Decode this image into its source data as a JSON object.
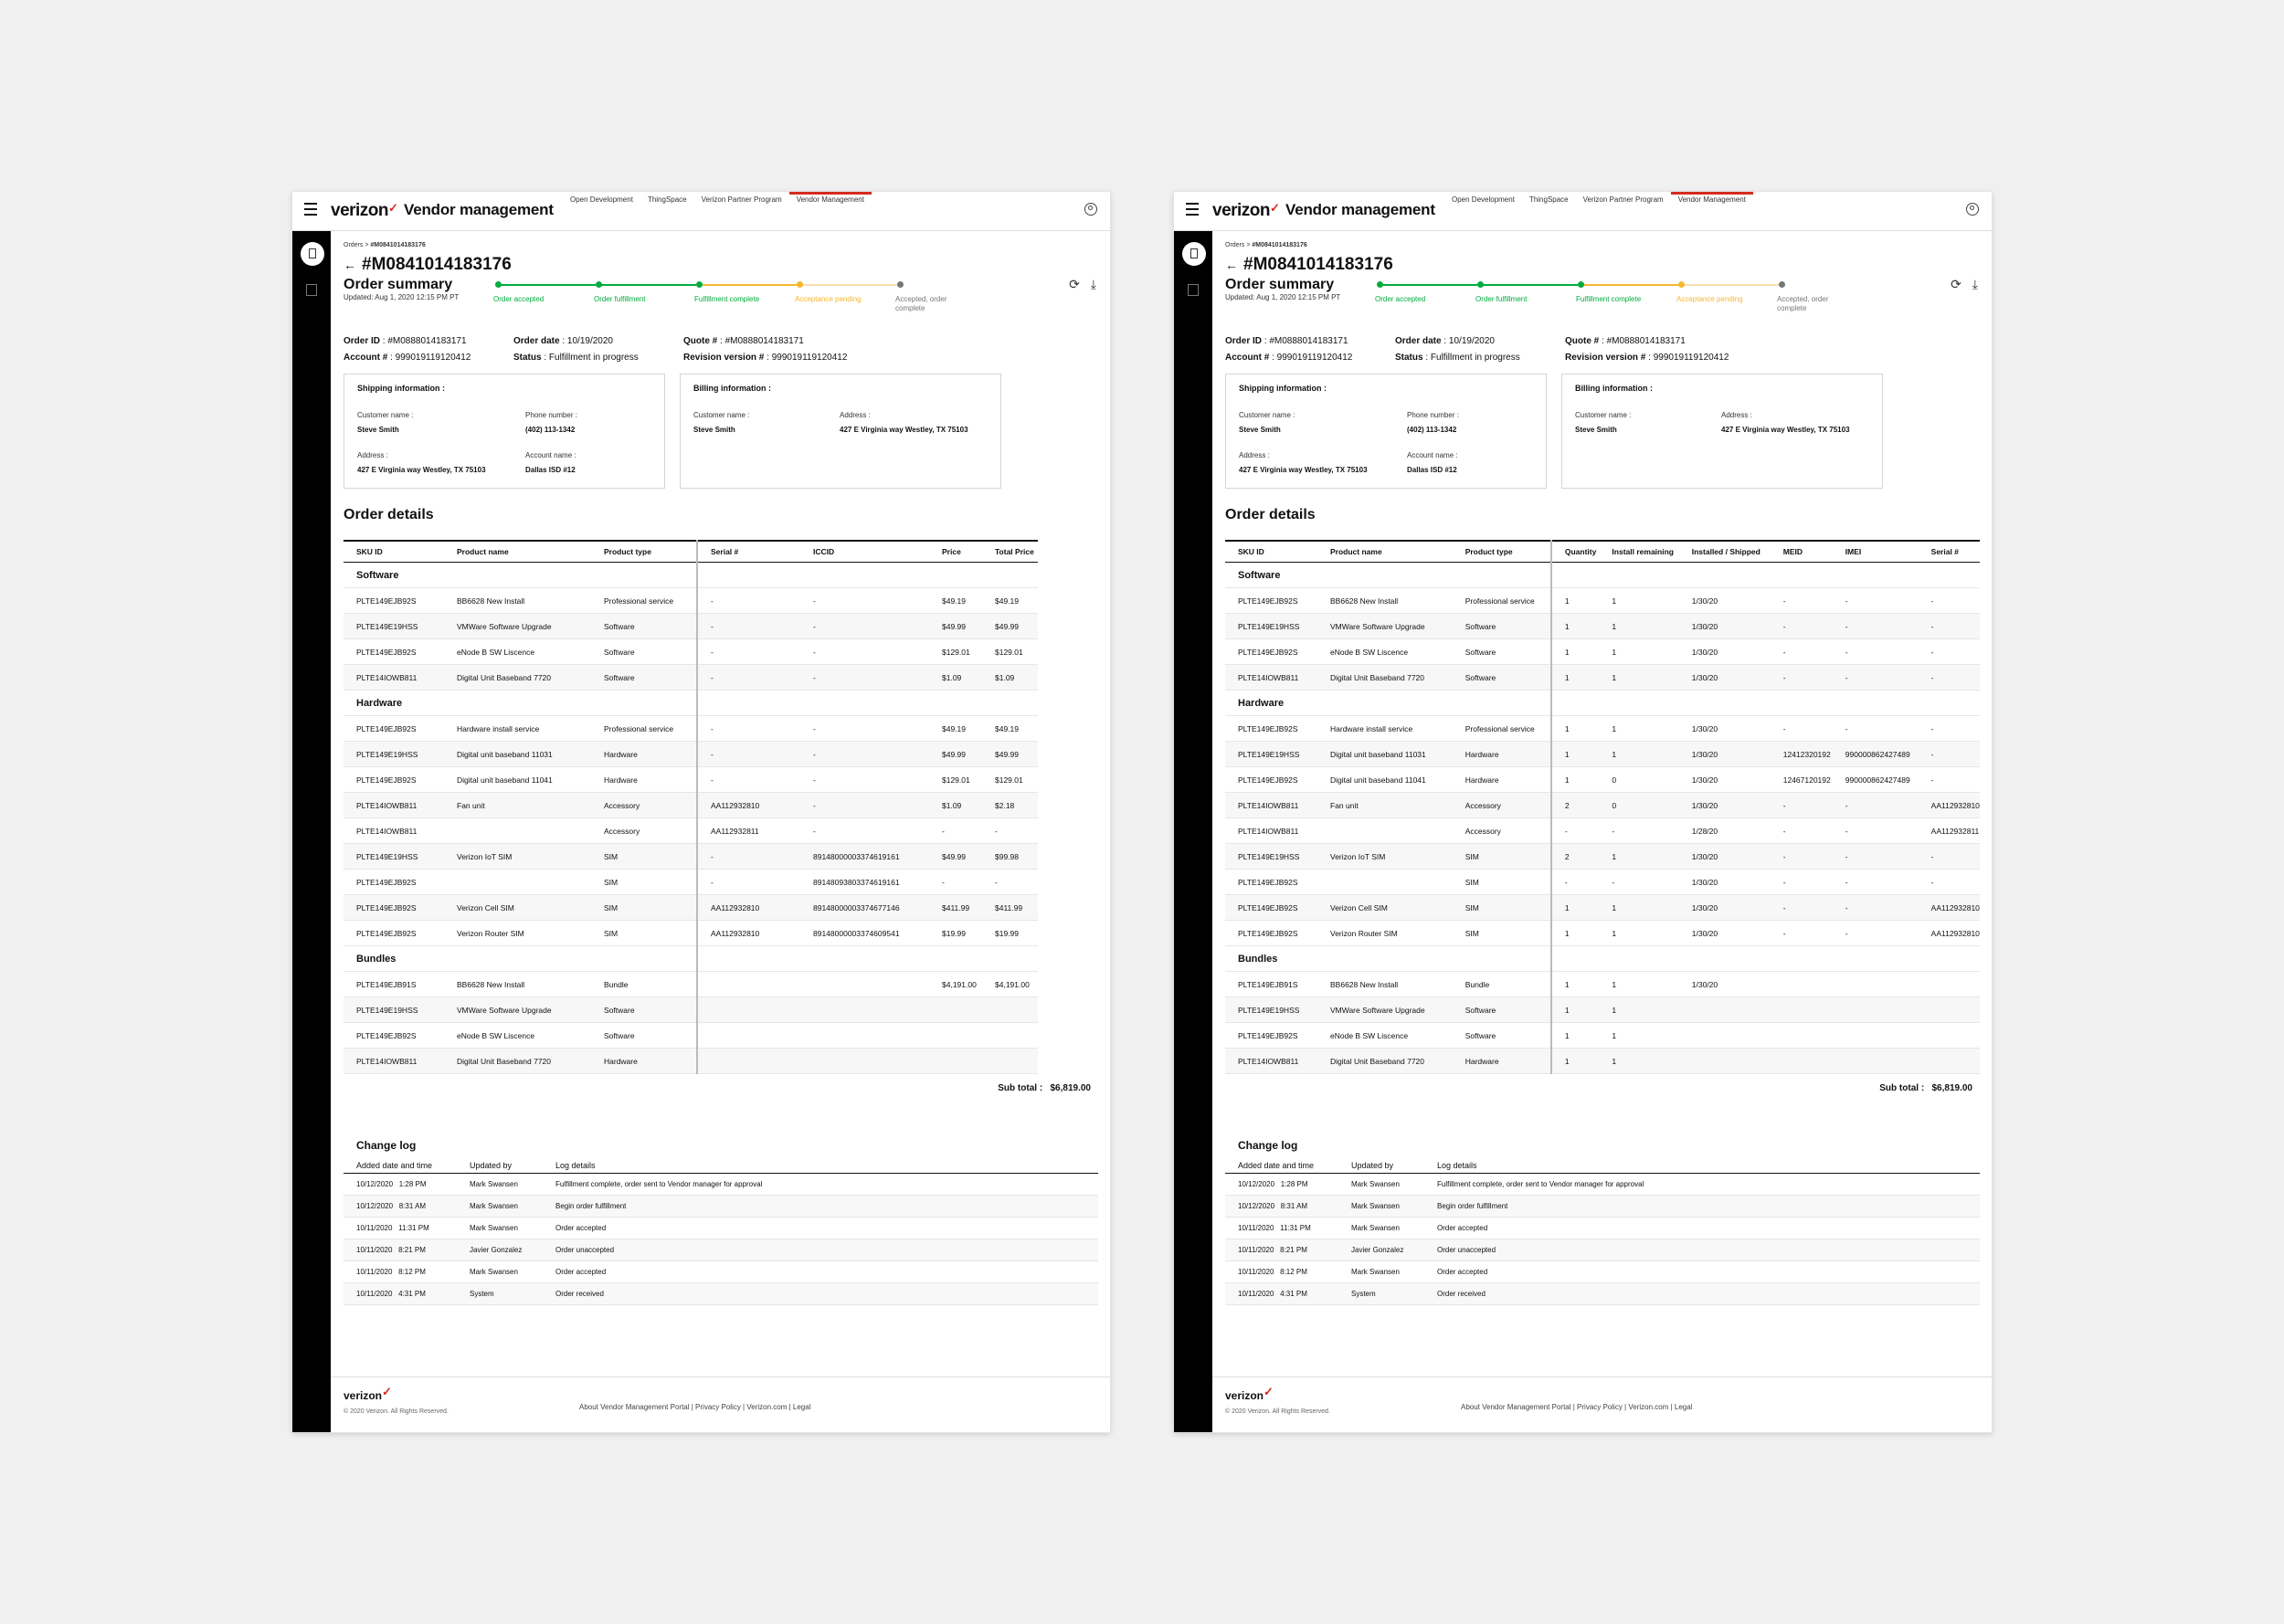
{
  "app": {
    "brand": "verizon",
    "brand_check": "✓",
    "title": "Vendor management",
    "nav": [
      "Open Development",
      "ThingSpace",
      "Verizon Partner Program",
      "Vendor Management"
    ]
  },
  "breadcrumb": {
    "root": "Orders",
    "current": "#M0841014183176"
  },
  "order": {
    "number": "#M0841014183176"
  },
  "summary": {
    "title": "Order summary",
    "updated": "Updated: Aug 1, 2020  12:15 PM PT",
    "steps": [
      {
        "label": "Order accepted",
        "status": "done"
      },
      {
        "label": "Order fulfillment",
        "status": "done"
      },
      {
        "label": "Fulfillment complete",
        "status": "done"
      },
      {
        "label": "Acceptance pending",
        "status": "pending"
      },
      {
        "label": "Accepted, order complete",
        "status": "todo"
      }
    ]
  },
  "meta": {
    "order_id_label": "Order ID",
    "order_id": ": #M0888014183171",
    "order_date_label": "Order date",
    "order_date": ": 10/19/2020",
    "quote_label": "Quote #",
    "quote": ": #M0888014183171",
    "account_label": "Account #",
    "account": ": 999019119120412",
    "status_label": "Status",
    "status": ": Fulfillment in progress",
    "revision_label": "Revision version #",
    "revision": ": 999019119120412"
  },
  "shipping": {
    "title": "Shipping information :",
    "customer_label": "Customer name :",
    "customer": "Steve Smith",
    "phone_label": "Phone number :",
    "phone": "(402) 113-1342",
    "address_label": "Address :",
    "address": "427 E Virginia way Westley, TX 75103",
    "account_label": "Account name :",
    "account": "Dallas ISD #12"
  },
  "billing": {
    "title": "Billing information :",
    "customer_label": "Customer name :",
    "customer": "Steve Smith",
    "address_label": "Address :",
    "address": "427 E Virginia way Westley, TX 75103"
  },
  "order_details": {
    "title": "Order details",
    "sub_total_label": "Sub total :",
    "sub_total": "$6,819.00",
    "columns_a": [
      "SKU ID",
      "Product name",
      "Product type",
      "Serial #",
      "ICCID",
      "Price",
      "Total Price"
    ],
    "columns_b": [
      "SKU ID",
      "Product name",
      "Product type",
      "Quantity",
      "Install remaining",
      "Installed / Shipped",
      "MEID",
      "IMEI",
      "Serial #"
    ],
    "groups": [
      {
        "name": "Software",
        "rows": [
          {
            "sku": "PLTE149EJB92S",
            "name": "BB6628 New Install",
            "type": "Professional service",
            "serial": "-",
            "iccid": "-",
            "price": "$49.19",
            "total": "$49.19",
            "qty": "1",
            "rem": "1",
            "inst": "1/30/20",
            "meid": "-",
            "imei": "-",
            "serialb": "-"
          },
          {
            "sku": "PLTE149E19HSS",
            "name": "VMWare Software Upgrade",
            "type": "Software",
            "serial": "-",
            "iccid": "-",
            "price": "$49.99",
            "total": "$49.99",
            "qty": "1",
            "rem": "1",
            "inst": "1/30/20",
            "meid": "-",
            "imei": "-",
            "serialb": "-"
          },
          {
            "sku": "PLTE149EJB92S",
            "name": "eNode B SW Liscence",
            "type": "Software",
            "serial": "-",
            "iccid": "-",
            "price": "$129.01",
            "total": "$129.01",
            "qty": "1",
            "rem": "1",
            "inst": "1/30/20",
            "meid": "-",
            "imei": "-",
            "serialb": "-"
          },
          {
            "sku": "PLTE14IOWB811",
            "name": "Digital Unit Baseband 7720",
            "type": "Software",
            "serial": "-",
            "iccid": "-",
            "price": "$1.09",
            "total": "$1.09",
            "qty": "1",
            "rem": "1",
            "inst": "1/30/20",
            "meid": "-",
            "imei": "-",
            "serialb": "-"
          }
        ]
      },
      {
        "name": "Hardware",
        "rows": [
          {
            "sku": "PLTE149EJB92S",
            "name": "Hardware install service",
            "type": "Professional service",
            "serial": "-",
            "iccid": "-",
            "price": "$49.19",
            "total": "$49.19",
            "qty": "1",
            "rem": "1",
            "inst": "1/30/20",
            "meid": "-",
            "imei": "-",
            "serialb": "-"
          },
          {
            "sku": "PLTE149E19HSS",
            "name": "Digital unit baseband 11031",
            "type": "Hardware",
            "serial": "-",
            "iccid": "-",
            "price": "$49.99",
            "total": "$49.99",
            "qty": "1",
            "rem": "1",
            "inst": "1/30/20",
            "meid": "12412320192",
            "imei": "990000862427489",
            "serialb": "-"
          },
          {
            "sku": "PLTE149EJB92S",
            "name": "Digital unit baseband 11041",
            "type": "Hardware",
            "serial": "-",
            "iccid": "-",
            "price": "$129.01",
            "total": "$129.01",
            "qty": "1",
            "rem": "0",
            "inst": "1/30/20",
            "meid": "12467120192",
            "imei": "990000862427489",
            "serialb": "-"
          },
          {
            "sku": "PLTE14IOWB811",
            "name": "Fan unit",
            "type": "Accessory",
            "serial": "AA112932810",
            "iccid": "-",
            "price": "$1.09",
            "total": "$2.18",
            "qty": "2",
            "rem": "0",
            "inst": "1/30/20",
            "meid": "-",
            "imei": "-",
            "serialb": "AA112932810"
          },
          {
            "sku": "PLTE14IOWB811",
            "name": "",
            "type": "Accessory",
            "serial": "AA112932811",
            "iccid": "-",
            "price": "-",
            "total": "-",
            "qty": "-",
            "rem": "-",
            "inst": "1/28/20",
            "meid": "-",
            "imei": "-",
            "serialb": "AA112932811"
          },
          {
            "sku": "PLTE149E19HSS",
            "name": "Verizon IoT SIM",
            "type": "SIM",
            "serial": "-",
            "iccid": "89148000003374619161",
            "price": "$49.99",
            "total": "$99.98",
            "qty": "2",
            "rem": "1",
            "inst": "1/30/20",
            "meid": "-",
            "imei": "-",
            "serialb": "-"
          },
          {
            "sku": "PLTE149EJB92S",
            "name": "",
            "type": "SIM",
            "serial": "-",
            "iccid": "89148093803374619161",
            "price": "-",
            "total": "-",
            "qty": "-",
            "rem": "-",
            "inst": "1/30/20",
            "meid": "-",
            "imei": "-",
            "serialb": "-"
          },
          {
            "sku": "PLTE149EJB92S",
            "name": "Verizon Cell SIM",
            "type": "SIM",
            "serial": "AA112932810",
            "iccid": "89148000003374677146",
            "price": "$411.99",
            "total": "$411.99",
            "qty": "1",
            "rem": "1",
            "inst": "1/30/20",
            "meid": "-",
            "imei": "-",
            "serialb": "AA112932810"
          },
          {
            "sku": "PLTE149EJB92S",
            "name": "Verizon Router SIM",
            "type": "SIM",
            "serial": "AA112932810",
            "iccid": "89148000003374609541",
            "price": "$19.99",
            "total": "$19.99",
            "qty": "1",
            "rem": "1",
            "inst": "1/30/20",
            "meid": "-",
            "imei": "-",
            "serialb": "AA112932810"
          }
        ]
      },
      {
        "name": "Bundles",
        "rows": [
          {
            "sku": "PLTE149EJB91S",
            "name": "BB6628 New Install",
            "type": "Bundle",
            "serial": "",
            "iccid": "",
            "price": "$4,191.00",
            "total": "$4,191.00",
            "qty": "1",
            "rem": "1",
            "inst": "1/30/20",
            "meid": "",
            "imei": "",
            "serialb": ""
          },
          {
            "sku": "PLTE149E19HSS",
            "name": "VMWare Software Upgrade",
            "type": "Software",
            "serial": "",
            "iccid": "",
            "price": "",
            "total": "",
            "qty": "1",
            "rem": "1",
            "inst": "",
            "meid": "",
            "imei": "",
            "serialb": ""
          },
          {
            "sku": "PLTE149EJB92S",
            "name": "eNode B SW Liscence",
            "type": "Software",
            "serial": "",
            "iccid": "",
            "price": "",
            "total": "",
            "qty": "1",
            "rem": "1",
            "inst": "",
            "meid": "",
            "imei": "",
            "serialb": ""
          },
          {
            "sku": "PLTE14IOWB811",
            "name": "Digital Unit Baseband 7720",
            "type": "Hardware",
            "serial": "",
            "iccid": "",
            "price": "",
            "total": "",
            "qty": "1",
            "rem": "1",
            "inst": "",
            "meid": "",
            "imei": "",
            "serialb": ""
          }
        ]
      }
    ]
  },
  "change_log": {
    "title": "Change log",
    "columns": [
      "Added date and time",
      "Updated by",
      "Log details"
    ],
    "rows": [
      {
        "date": "10/12/2020",
        "time": "1:28 PM",
        "by": "Mark Swansen",
        "details": "Fulfillment complete, order sent to Vendor manager for approval"
      },
      {
        "date": "10/12/2020",
        "time": "8:31 AM",
        "by": "Mark Swansen",
        "details": "Begin order fulfillment"
      },
      {
        "date": "10/11/2020",
        "time": "11:31 PM",
        "by": "Mark Swansen",
        "details": "Order accepted"
      },
      {
        "date": "10/11/2020",
        "time": "8:21 PM",
        "by": "Javier Gonzalez",
        "details": "Order unaccepted"
      },
      {
        "date": "10/11/2020",
        "time": "8:12 PM",
        "by": "Mark Swansen",
        "details": "Order accepted"
      },
      {
        "date": "10/11/2020",
        "time": "4:31 PM",
        "by": "System",
        "details": "Order received"
      }
    ]
  },
  "footer": {
    "brand": "verizon",
    "copyright": "© 2020 Verizon. All Rights Reserved.",
    "links": "About Vendor Management Portal  |  Privacy Policy  |  Verizon.com  |  Legal"
  },
  "icons": {
    "refresh": "refresh-icon",
    "download": "download-icon",
    "back": "arrow-left-icon",
    "menu": "hamburger-icon",
    "user": "user-icon"
  },
  "colors": {
    "accent": "#d52b1e",
    "done": "#00ac3e",
    "pending": "#f5b82e",
    "todo": "#747676"
  }
}
